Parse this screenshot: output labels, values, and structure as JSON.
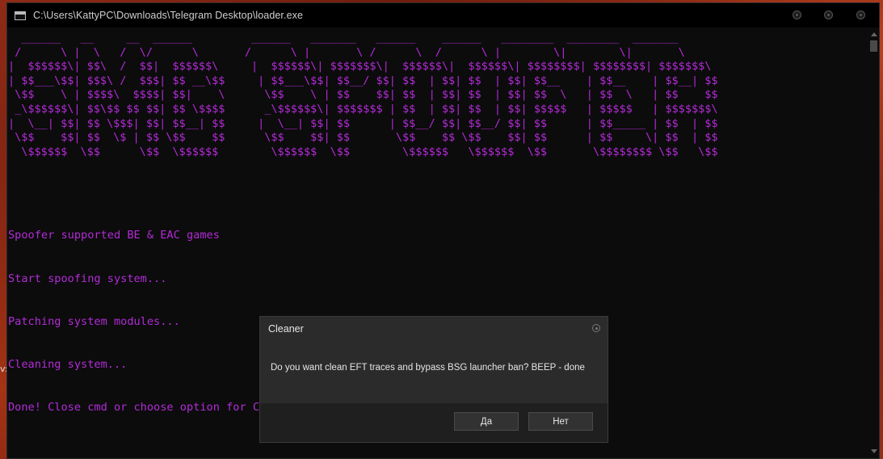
{
  "window": {
    "title": "C:\\Users\\KattyPC\\Downloads\\Telegram Desktop\\loader.exe"
  },
  "console": {
    "banner": "  ______   __     __  ______         ______   _______   ______    ______   ________  ________  _______\n /      \\ |  \\   /  \\/      \\       /      \\ |       \\ /      \\  /      \\ |        \\|        \\|       \\\n|  $$$$$$\\| $$\\  /  $$|  $$$$$$\\     |  $$$$$$\\| $$$$$$$\\|  $$$$$$\\|  $$$$$$\\| $$$$$$$$| $$$$$$$$| $$$$$$$\\\n| $$___\\$$| $$$\\ /  $$$| $$ __\\$$     | $$___\\$$| $$__/ $$| $$  | $$| $$  | $$| $$__    | $$__    | $$__| $$\n \\$$    \\ | $$$$\\  $$$$| $$|    \\      \\$$    \\ | $$    $$| $$  | $$| $$  | $$| $$  \\   | $$  \\   | $$    $$\n _\\$$$$$$\\| $$\\$$ $$ $$| $$ \\$$$$      _\\$$$$$$\\| $$$$$$$ | $$  | $$| $$  | $$| $$$$$   | $$$$$   | $$$$$$$\\\n|  \\__| $$| $$ \\$$$| $$| $$__| $$     |  \\__| $$| $$      | $$__/ $$| $$__/ $$| $$      | $$_____ | $$  | $$\n \\$$    $$| $$  \\$ | $$ \\$$    $$      \\$$    $$| $$       \\$$    $$ \\$$    $$| $$      | $$     \\| $$  | $$\n  \\$$$$$$  \\$$      \\$$  \\$$$$$$        \\$$$$$$  \\$$        \\$$$$$$   \\$$$$$$  \\$$       \\$$$$$$$$ \\$$   \\$$",
    "lines": [
      "Spoofer supported BE & EAC games",
      "Start spoofing system...",
      "Patching system modules...",
      "Cleaning system...",
      "Done! Close cmd or choose option for Cleaner"
    ]
  },
  "dialog": {
    "title": "Cleaner",
    "message": "Do you want clean EFT traces and bypass BSG launcher ban? BEEP - done",
    "yes_label": "Да",
    "no_label": "Нет"
  },
  "desktop": {
    "stray_text": "v:"
  },
  "colors": {
    "console_text": "#b32bd8",
    "console_bg": "#0c0c0c",
    "dialog_bg": "#2b2b2b"
  }
}
